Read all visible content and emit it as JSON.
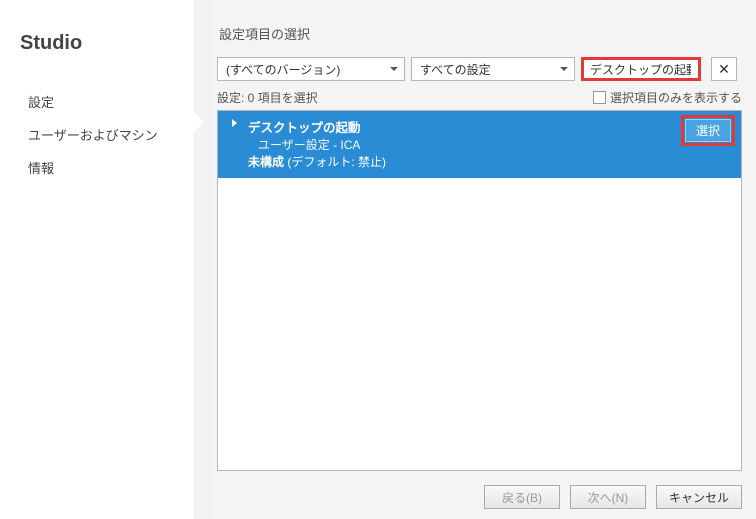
{
  "sidebar": {
    "title": "Studio",
    "items": [
      {
        "label": "設定"
      },
      {
        "label": "ユーザーおよびマシン"
      },
      {
        "label": "情報"
      }
    ]
  },
  "page": {
    "title": "設定項目の選択"
  },
  "filters": {
    "version_label": "(すべてのバージョン)",
    "settings_label": "すべての設定",
    "search_value": "デスクトップの起動"
  },
  "status": {
    "count_label": "設定: 0 項目を選択",
    "show_only_label": "選択項目のみを表示する"
  },
  "list": {
    "row": {
      "title": "デスクトップの起動",
      "subtitle": "ユーザー設定 - ICA",
      "state_strong": "未構成",
      "state_rest": " (デフォルト: 禁止)",
      "select_label": "選択"
    }
  },
  "footer": {
    "back": "戻る(B)",
    "next": "次へ(N)",
    "cancel": "キャンセル"
  }
}
